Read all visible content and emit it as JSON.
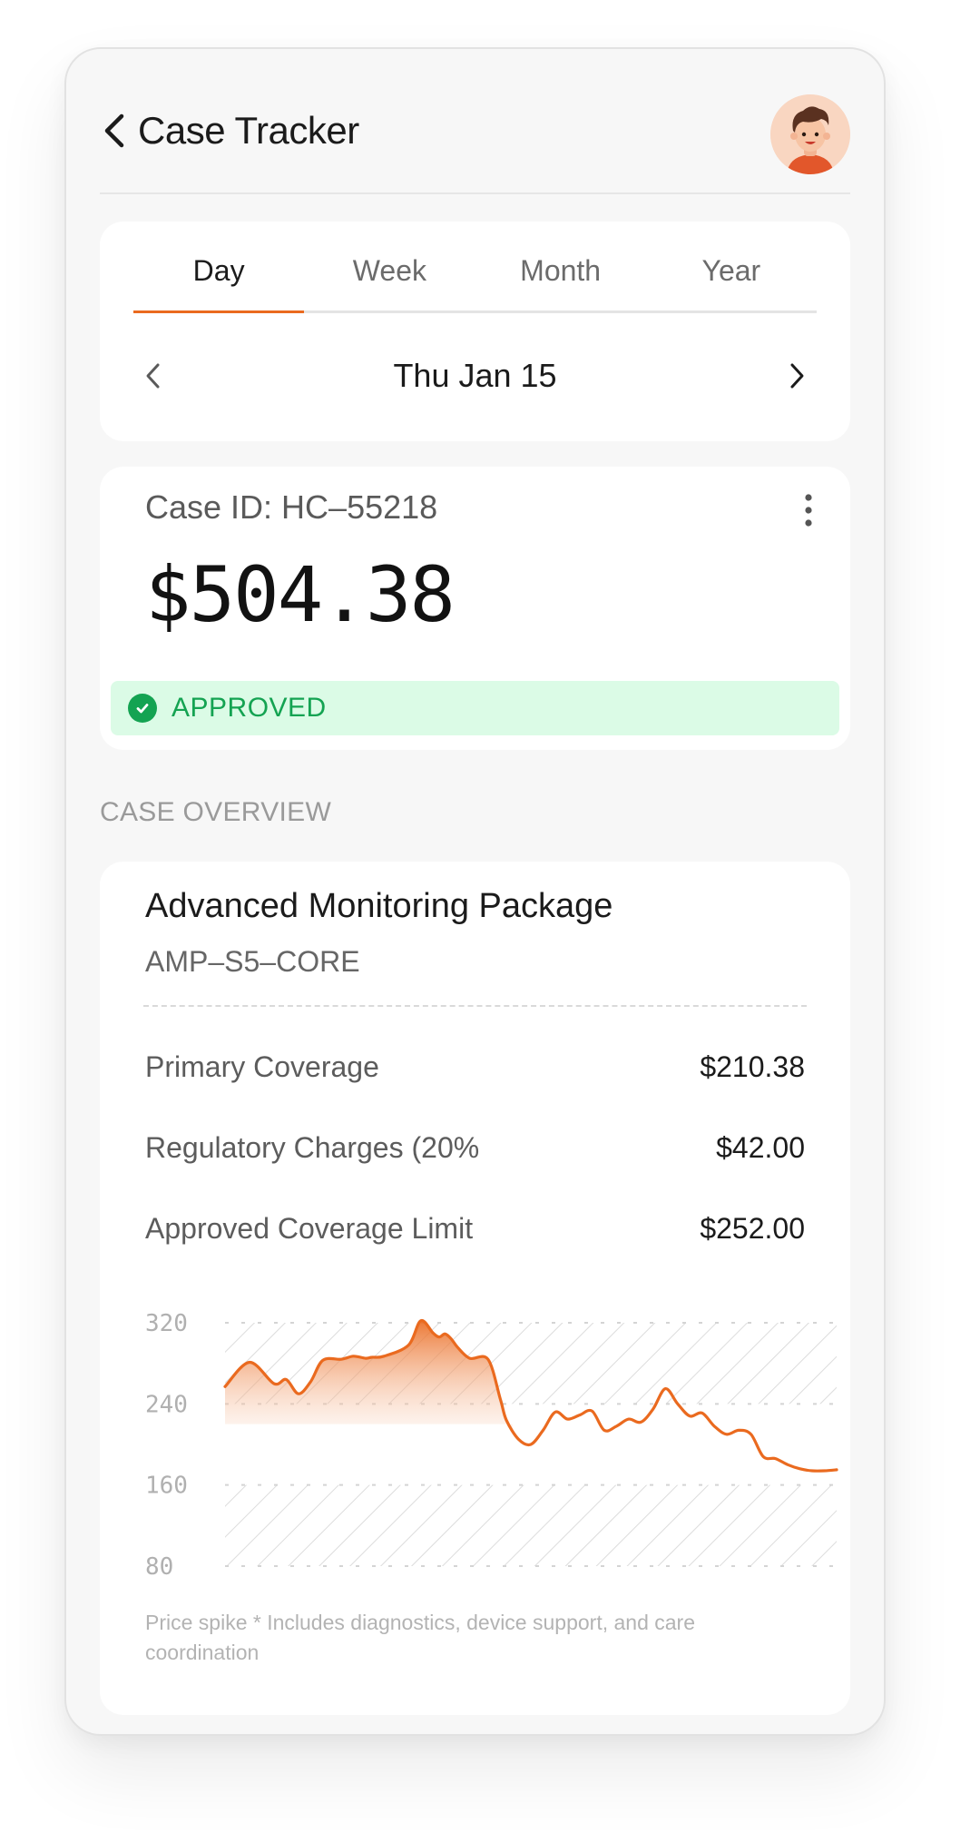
{
  "header": {
    "title": "Case Tracker",
    "back_icon": "chevron-left-icon",
    "avatar_icon": "user-avatar-icon"
  },
  "tabs": [
    {
      "label": "Day",
      "active": true
    },
    {
      "label": "Week",
      "active": false
    },
    {
      "label": "Month",
      "active": false
    },
    {
      "label": "Year",
      "active": false
    }
  ],
  "date_nav": {
    "date": "Thu Jan 15",
    "prev_icon": "chevron-left-icon",
    "next_icon": "chevron-right-icon"
  },
  "case": {
    "id_label": "Case ID: HC–55218",
    "amount": "$504.38",
    "status": "APPROVED",
    "status_color": "#14a352",
    "status_bg": "#dbfbe6"
  },
  "overview": {
    "section_label": "CASE OVERVIEW",
    "package_name": "Advanced Monitoring Package",
    "package_code": "AMP–S5–CORE",
    "rows": [
      {
        "label": "Primary Coverage",
        "value": "$210.38"
      },
      {
        "label": "Regulatory Charges (20%",
        "value": "$42.00"
      },
      {
        "label": "Approved Coverage Limit",
        "value": "$252.00"
      }
    ],
    "note": "Price spike * Includes diagnostics, device support, and care coordination"
  },
  "accent_color": "#ea6a1f",
  "chart_data": {
    "type": "area",
    "title": "",
    "xlabel": "",
    "ylabel": "",
    "ylim": [
      80,
      320
    ],
    "yticks": [
      320,
      240,
      160,
      80
    ],
    "grid": "hatched bands 80–160 and 240–320",
    "highlight_region_x": [
      0,
      47
    ],
    "series": [
      {
        "x": [
          0,
          4,
          8,
          10,
          12,
          14,
          16,
          19,
          21,
          23,
          24,
          26,
          30,
          32,
          34,
          35,
          36,
          37,
          38,
          40,
          43,
          45,
          46,
          48,
          50,
          52,
          54,
          56,
          58,
          60,
          62,
          64,
          66,
          68,
          70,
          72,
          74,
          76,
          78,
          80,
          82,
          84,
          86,
          88,
          90,
          92,
          94,
          96,
          98,
          100
        ],
        "y": [
          257,
          281,
          260,
          264,
          250,
          262,
          283,
          284,
          287,
          285,
          286,
          287,
          298,
          322,
          310,
          306,
          309,
          304,
          296,
          285,
          284,
          245,
          224,
          205,
          200,
          214,
          232,
          225,
          229,
          233,
          214,
          218,
          225,
          222,
          235,
          255,
          240,
          228,
          231,
          218,
          210,
          214,
          210,
          188,
          186,
          180,
          176,
          174,
          174,
          175
        ]
      }
    ]
  }
}
